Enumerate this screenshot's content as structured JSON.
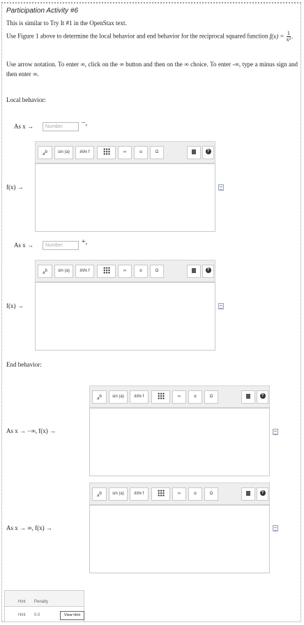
{
  "header": {
    "title": "Participation Activity #6",
    "line1": "This is similar to Try It #1 in the OpenStax text.",
    "line2_a": "Use Figure 1 above to determine the local behavior and end behavior for the reciprocal squared function",
    "func_label": "f(x) =",
    "func_num": "1",
    "func_den": "x²",
    "line3": "Use arrow notation. To enter ∞, click on the ∞ button and then on the ∞ choice. To enter -∞, type a minus sign and then enter ∞."
  },
  "sections": {
    "local": "Local behavior:",
    "end": "End behavior:"
  },
  "local": [
    {
      "as_prefix": "As x →",
      "placeholder": "Number",
      "suffix": "−,",
      "fx_label": "f(x) →"
    },
    {
      "as_prefix": "As x →",
      "placeholder": "Number",
      "suffix": "+,",
      "fx_label": "f(x) →"
    }
  ],
  "end": [
    {
      "label": "As x → −∞, f(x) →"
    },
    {
      "label": "As x → ∞, f(x) →"
    }
  ],
  "toolbar": {
    "sup": "a",
    "sup_b": "b",
    "sin": "sin (a)",
    "deriv": "∂/∂x f",
    "infinity": "∞",
    "alpha": "α",
    "omega": "Ω",
    "help": "?"
  },
  "icons": [
    "superscript-icon",
    "sin-icon",
    "derivative-icon",
    "matrix-icon",
    "infinity-icon",
    "alpha-icon",
    "omega-icon",
    "trash-icon",
    "help-icon",
    "document-icon"
  ],
  "hint_table": {
    "headers": [
      "Hint",
      "Penalty"
    ],
    "row": [
      "Hint",
      "0.0"
    ],
    "button": "View Hint"
  }
}
